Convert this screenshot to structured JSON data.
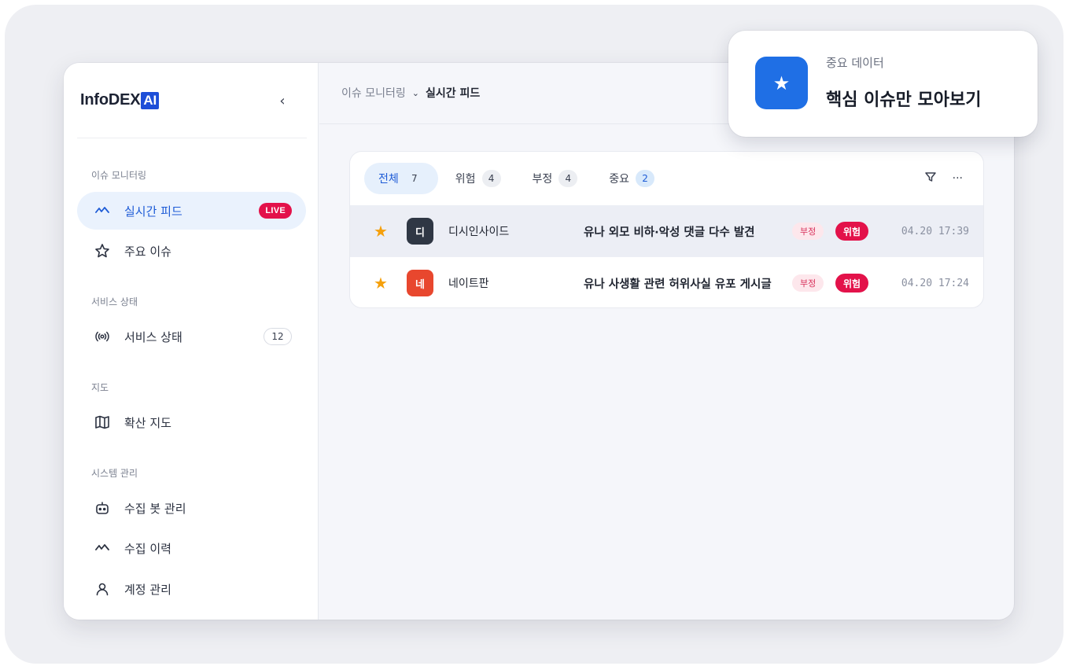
{
  "brand": {
    "name": "InfoDEX",
    "ai": "AI"
  },
  "sidebar": {
    "collapse_glyph": "‹",
    "sections": [
      {
        "title": "이슈 모니터링"
      },
      {
        "title": "서비스 상태"
      },
      {
        "title": "지도"
      },
      {
        "title": "시스템 관리"
      }
    ],
    "items": [
      {
        "label": "실시간 피드",
        "icon": "activity-icon",
        "badge": "LIVE",
        "active": true
      },
      {
        "label": "주요 이슈",
        "icon": "star-outline-icon"
      },
      {
        "label": "서비스 상태",
        "icon": "broadcast-icon",
        "count": "12"
      },
      {
        "label": "확산 지도",
        "icon": "map-icon"
      },
      {
        "label": "수집 봇 관리",
        "icon": "bot-icon"
      },
      {
        "label": "수집 이력",
        "icon": "activity-icon"
      },
      {
        "label": "계정 관리",
        "icon": "user-icon"
      }
    ]
  },
  "breadcrumb": {
    "parent": "이슈 모니터링",
    "current": "실시간 피드"
  },
  "tabs": [
    {
      "label": "전체",
      "count": "7",
      "active": true
    },
    {
      "label": "위험",
      "count": "4"
    },
    {
      "label": "부정",
      "count": "4"
    },
    {
      "label": "중요",
      "count": "2"
    }
  ],
  "tools": {
    "more": "···"
  },
  "feed": [
    {
      "source_initial": "디",
      "source": "디시인사이드",
      "source_color": "#2f3744",
      "title": "유나 외모 비하·악성 댓글 다수 발견",
      "sentiment": "부정",
      "risk": "위험",
      "time": "04.20 17:39"
    },
    {
      "source_initial": "네",
      "source": "네이트판",
      "source_color": "#e8472e",
      "title": "유나 사생활 관련 허위사실 유포 게시글",
      "sentiment": "부정",
      "risk": "위험",
      "time": "04.20 17:24"
    }
  ],
  "highlight_card": {
    "subtitle": "중요 데이터",
    "title": "핵심 이슈만 모아보기",
    "icon": "★"
  },
  "colors": {
    "accent": "#1d5bd6",
    "danger": "#e3124a",
    "star": "#f5a00c"
  }
}
